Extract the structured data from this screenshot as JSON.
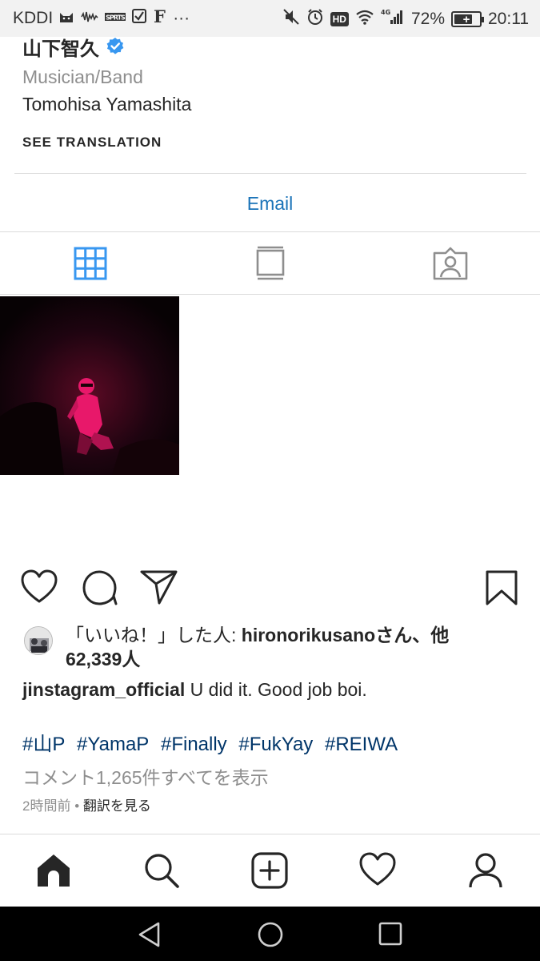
{
  "status_bar": {
    "carrier": "KDDI",
    "app_icons": [
      "cat-icon",
      "signal-wave-icon",
      "sport-app-icon",
      "check-box-icon",
      "f-icon"
    ],
    "more": "···",
    "hd": "HD",
    "network": "4G",
    "battery_percent": "72%",
    "battery_level": 0.72,
    "time": "20:11"
  },
  "profile": {
    "name": "山下智久",
    "category": "Musician/Band",
    "full_name": "Tomohisa Yamashita",
    "see_translation": "SEE TRANSLATION",
    "email_button": "Email"
  },
  "tabs": [
    {
      "name": "grid",
      "icon": "grid-icon",
      "active": true
    },
    {
      "name": "feed",
      "icon": "feed-icon",
      "active": false
    },
    {
      "name": "tagged",
      "icon": "tagged-icon",
      "active": false
    }
  ],
  "post": {
    "likes_prefix": "「いいね！」した人: ",
    "likes_user": "hironorikusano",
    "likes_suffix": "さん、他",
    "likes_count": "62,339人",
    "caption_user": "jinstagram_official",
    "caption_text": " U did it. Good job boi.",
    "hashtags": [
      "#山P",
      "#YamaP",
      "#Finally",
      "#FukYay",
      "#REIWA"
    ],
    "view_comments": "コメント1,265件すべてを表示",
    "time_ago": "2時間前",
    "separator": " • ",
    "see_translation": "翻訳を見る"
  },
  "colors": {
    "link_blue": "#1a73b8",
    "hashtag": "#003569",
    "verified": "#3897f0",
    "active_tab": "#3897f0",
    "secondary_text": "#8e8e8e",
    "photo_tint": "#e8186a"
  }
}
